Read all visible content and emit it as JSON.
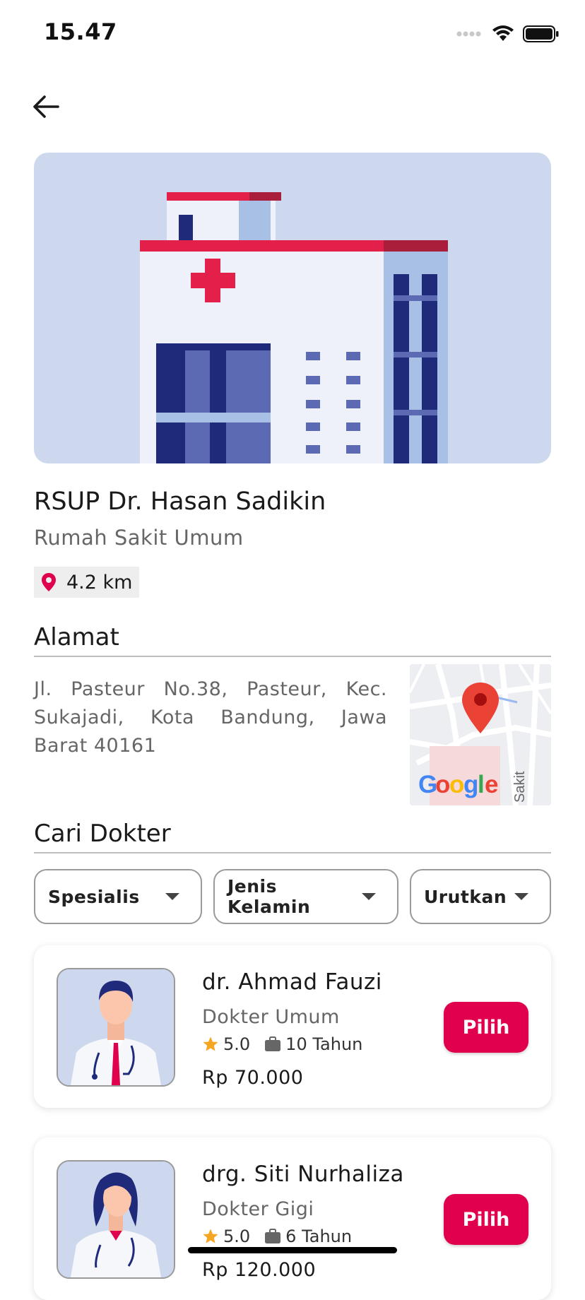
{
  "status_bar": {
    "time": "15.47"
  },
  "hospital": {
    "name": "RSUP Dr. Hasan Sadikin",
    "type": "Rumah Sakit Umum",
    "distance": "4.2 km"
  },
  "address_section": {
    "title": "Alamat",
    "text": "Jl. Pasteur No.38, Pasteur, Kec. Sukajadi, Kota Bandung, Jawa Barat 40161",
    "map_logo": "Google",
    "map_street_label": "Sakit"
  },
  "doctor_section": {
    "title": "Cari Dokter",
    "filters": [
      {
        "label": "Spesialis"
      },
      {
        "label": "Jenis Kelamin"
      },
      {
        "label": "Urutkan"
      }
    ],
    "doctors": [
      {
        "name": "dr. Ahmad Fauzi",
        "specialty": "Dokter Umum",
        "rating": "5.0",
        "experience": "10 Tahun",
        "price": "Rp 70.000",
        "button": "Pilih"
      },
      {
        "name": "drg. Siti Nurhaliza",
        "specialty": "Dokter Gigi",
        "rating": "5.0",
        "experience": "6 Tahun",
        "price": "Rp 120.000",
        "button": "Pilih"
      }
    ]
  },
  "colors": {
    "accent": "#e0004d",
    "hero_bg": "#cdd8ef",
    "star": "#f5a623"
  }
}
